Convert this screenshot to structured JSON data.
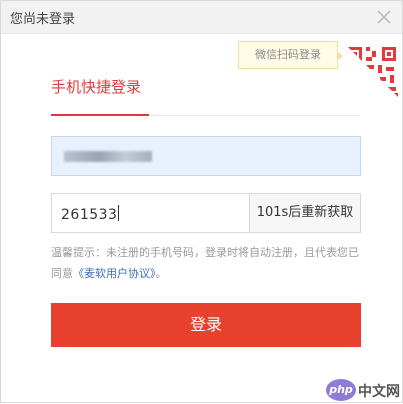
{
  "window": {
    "title": "您尚未登录"
  },
  "qr": {
    "hint": "微信扫码登录"
  },
  "tabs": {
    "active_label": "手机快捷登录"
  },
  "form": {
    "code_value": "261533",
    "resend_label": "101s后重新获取",
    "notice_text": "温馨提示：未注册的手机号码，登录时将自动注册，且代表您已同意",
    "agreement_link": "《麦软用户协议》",
    "notice_end": "。",
    "login_label": "登录"
  },
  "watermark": {
    "badge": "php",
    "text": "中文网"
  },
  "colors": {
    "accent": "#e4393c",
    "button": "#e8412d",
    "link": "#3b6fb6"
  }
}
